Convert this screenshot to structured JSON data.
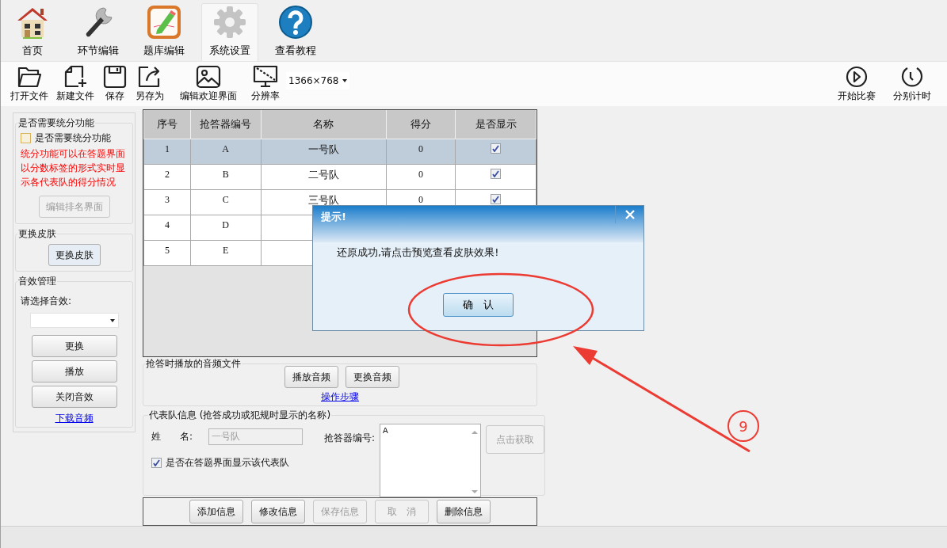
{
  "nav_tabs": [
    {
      "label": "首页",
      "selected": false
    },
    {
      "label": "环节编辑",
      "selected": false
    },
    {
      "label": "题库编辑",
      "selected": false
    },
    {
      "label": "系统设置",
      "selected": true
    },
    {
      "label": "查看教程",
      "selected": false
    }
  ],
  "toolbar": {
    "left": [
      {
        "label": "打开文件"
      },
      {
        "label": "新建文件"
      },
      {
        "label": "保存"
      },
      {
        "label": "另存为"
      },
      {
        "label": "编辑欢迎界面"
      },
      {
        "label": "分辨率"
      }
    ],
    "resolution": "1366×768",
    "right": [
      {
        "label": "开始比赛"
      },
      {
        "label": "分别计时"
      }
    ]
  },
  "scoring_group": {
    "title": "是否需要统分功能",
    "checkbox": {
      "label": "是否需要统分功能",
      "checked": false
    },
    "note": "统分功能可以在答题界面以分数标签的形式实时显示各代表队的得分情况",
    "button": {
      "label": "编辑排名界面",
      "disabled": true
    }
  },
  "skin_group": {
    "title": "更换皮肤",
    "button": {
      "label": "更换皮肤",
      "disabled": false
    }
  },
  "sound_group": {
    "title": "音效管理",
    "prompt": "请选择音效:",
    "buttons": [
      {
        "label": "更换",
        "disabled": false
      },
      {
        "label": "播放",
        "disabled": false
      },
      {
        "label": "关闭音效",
        "disabled": false
      }
    ],
    "link": "下载音频"
  },
  "table": {
    "columns": [
      "序号",
      "抢答器编号",
      "名称",
      "得分",
      "是否显示"
    ],
    "rows": [
      {
        "number": "1",
        "code": "A",
        "name": "一号队",
        "score": "0",
        "shown": true,
        "selected": true
      },
      {
        "number": "2",
        "code": "B",
        "name": "二号队",
        "score": "0",
        "shown": true,
        "selected": false
      },
      {
        "number": "3",
        "code": "C",
        "name": "三号队",
        "score": "0",
        "shown": true,
        "selected": false
      },
      {
        "number": "4",
        "code": "D",
        "selected": false
      },
      {
        "number": "5",
        "code": "E",
        "selected": false
      }
    ]
  },
  "audio_group": {
    "title": "抢答时播放的音频文件",
    "buttons": [
      {
        "label": "播放音频",
        "disabled": false
      },
      {
        "label": "更换音频",
        "disabled": false
      }
    ],
    "link": "操作步骤"
  },
  "team_group": {
    "title": "代表队信息 (抢答成功或犯规时显示的名称)",
    "name_label": "姓　　名:",
    "name_value": "一号队",
    "code_label": "抢答器编号:",
    "code_value": "A",
    "fetch_button": {
      "label": "点击获取",
      "disabled": true
    },
    "show_checkbox": {
      "label": "是否在答题界面显示该代表队",
      "checked": true
    }
  },
  "actions": [
    {
      "label": "添加信息",
      "disabled": false
    },
    {
      "label": "修改信息",
      "disabled": false
    },
    {
      "label": "保存信息",
      "disabled": true
    },
    {
      "label": "取　消",
      "disabled": true
    },
    {
      "label": "删除信息",
      "disabled": false
    }
  ],
  "dialog": {
    "title": "提示!",
    "message": "还原成功,请点击预览查看皮肤效果!",
    "button": "确　认"
  },
  "annotation": {
    "number": "9"
  }
}
